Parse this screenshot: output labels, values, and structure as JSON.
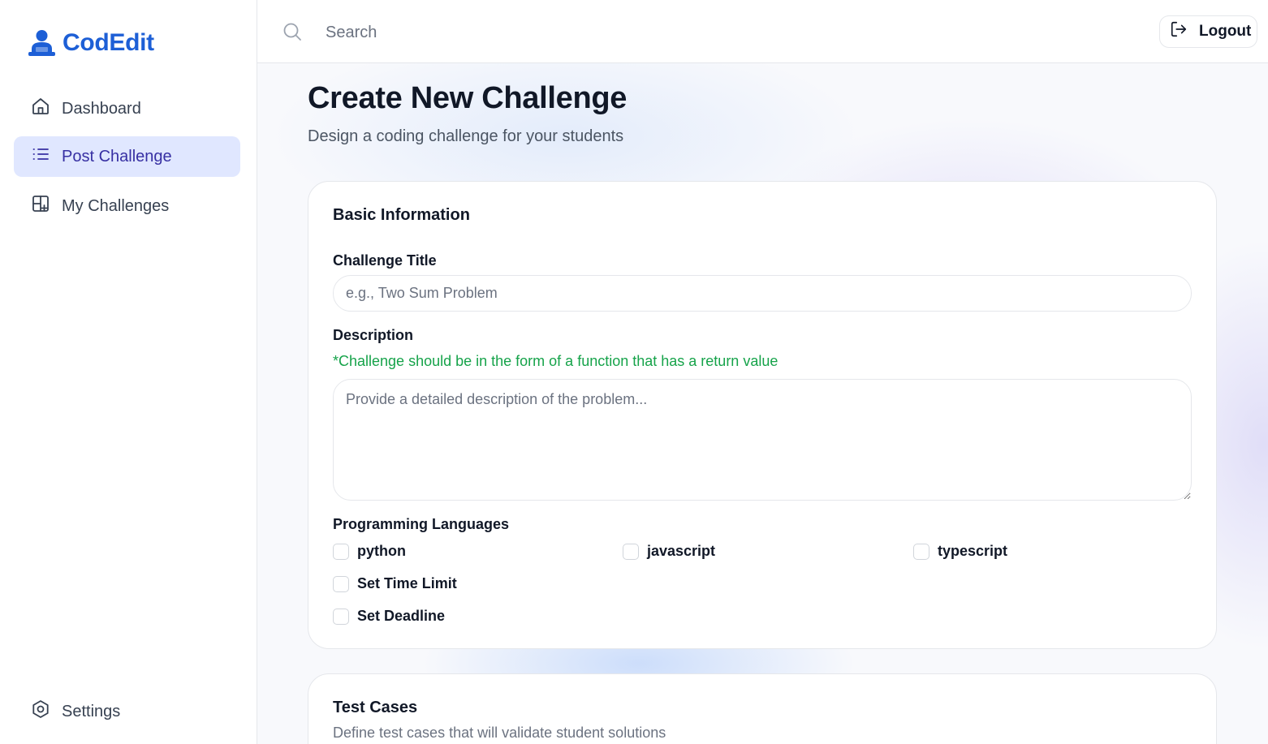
{
  "brand": {
    "name": "CodEdit",
    "color": "#1d5fd6",
    "icon": "user-laptop-icon"
  },
  "sidebar": {
    "items": [
      {
        "label": "Dashboard",
        "icon": "home-icon",
        "active": false
      },
      {
        "label": "Post Challenge",
        "icon": "list-icon",
        "active": true
      },
      {
        "label": "My Challenges",
        "icon": "grid-plus-icon",
        "active": false
      }
    ],
    "footer": {
      "label": "Settings",
      "icon": "settings-icon"
    }
  },
  "topbar": {
    "search": {
      "placeholder": "Search",
      "value": ""
    },
    "logout_label": "Logout"
  },
  "page": {
    "title": "Create New Challenge",
    "subtitle": "Design a coding challenge for your students"
  },
  "basic_info": {
    "title": "Basic Information",
    "challenge_title": {
      "label": "Challenge Title",
      "placeholder": "e.g., Two Sum Problem",
      "value": ""
    },
    "description": {
      "label": "Description",
      "hint": "*Challenge should be in the form of a function that has a return value",
      "placeholder": "Provide a detailed description of the problem...",
      "value": ""
    },
    "languages": {
      "label": "Programming Languages",
      "options": [
        {
          "label": "python",
          "checked": false
        },
        {
          "label": "javascript",
          "checked": false
        },
        {
          "label": "typescript",
          "checked": false
        }
      ]
    },
    "time_limit": {
      "label": "Set Time Limit",
      "checked": false
    },
    "deadline": {
      "label": "Set Deadline",
      "checked": false
    }
  },
  "test_cases": {
    "title": "Test Cases",
    "subtitle": "Define test cases that will validate student solutions"
  },
  "colors": {
    "accent": "#1d5fd6",
    "active_nav_bg": "#e0e7ff",
    "active_nav_text": "#3730a3",
    "hint_green": "#16a34a"
  }
}
